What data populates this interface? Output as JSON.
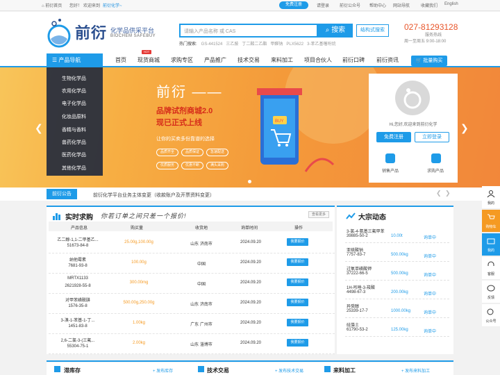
{
  "topbar": {
    "home": "前衍首页",
    "greeting": "您好！",
    "welcome": "欢迎来到",
    "site": "前衍化学~",
    "register": "免费注册",
    "login": "请登录",
    "wechat": "前衍公众号",
    "help": "帮助中心",
    "sitemap": "网站导航",
    "favorite": "收藏我们",
    "english": "English"
  },
  "header": {
    "logo_cn": "前衍",
    "logo_sub1": "化学品供采平台",
    "logo_sub2": "BIOCHEM SAFEBUY",
    "search_placeholder": "请输入产品名称 或 CAS",
    "search_btn": "搜索",
    "struct_search": "结构式搜索",
    "hot_label": "热门搜索:",
    "hot_words": [
      "GS-441524",
      "三乙胺",
      "丁二酸二乙酯",
      "甲醛钠",
      "PLX5622",
      "3-苯乙基噻吩烷"
    ],
    "phone": "027-81293128",
    "service_label": "服务热线",
    "service_time": "周一至周五 9:00-18:00"
  },
  "nav": {
    "category_head": "产品导航",
    "items": [
      "首页",
      "现货商城",
      "求购专区",
      "产品推广",
      "技术交易",
      "来料加工",
      "项目合伙人",
      "前衍口碑",
      "前衍资讯"
    ],
    "hot_badge": "HOT",
    "bulk_buy": "批量购买"
  },
  "categories": [
    "生物化学品",
    "农用化学品",
    "电子化学品",
    "化妆品原料",
    "香精与香料",
    "兽药化学品",
    "医药化学品",
    "其他化学品"
  ],
  "banner": {
    "title": "前衍 ——",
    "line1": "品牌试剂商城2.0",
    "line2": "现已正式上线",
    "line3": "让你的买卖多份靠谱的选择",
    "tags": [
      "品质齐全",
      "品质保证",
      "急速配送",
      "优质服务",
      "优惠不断",
      "满头采购"
    ],
    "phone_badge": "BUY"
  },
  "user_card": {
    "hi": "Hi,您好,欢迎来到前衍化学",
    "register": "免费注册",
    "login": "立即登录",
    "sell": "销售产品",
    "buy": "求购产品"
  },
  "notice": {
    "tag": "前衍公告",
    "text": "前衍化学平台业务主体变更（收款账户及开票资料变更）"
  },
  "purchase": {
    "title": "实时求购",
    "slogan": "你若订单之间只差一个报价!",
    "more": "查看更多",
    "headers": [
      "产品信息",
      "购买量",
      "收货地",
      "询单时间",
      "操作"
    ],
    "quote_label": "我要报价",
    "rows": [
      {
        "name": "乙二醇-1,1-二甲基乙...",
        "cas": "51673-84-8",
        "qty": "25.00g,100.00g",
        "loc": "山东 济南市",
        "date": "2024.09.20"
      },
      {
        "name": "纳他霉素",
        "cas": "7681-93-8",
        "qty": "100.00g",
        "loc": "中国",
        "date": "2024.09.20"
      },
      {
        "name": "MRTX1133",
        "cas": "2621928-55-8",
        "qty": "300.00mg",
        "loc": "中国",
        "date": "2024.09.20"
      },
      {
        "name": "对甲苯磺酰肼",
        "cas": "1576-35-8",
        "qty": "500.00g,250.00g",
        "loc": "山东 济南市",
        "date": "2024.09.20"
      },
      {
        "name": "3-溴-1-苯基-1-丁...",
        "cas": "1451-83-8",
        "qty": "1.00kg",
        "loc": "广东 广州市",
        "date": "2024.09.20"
      },
      {
        "name": "2,6-二氯-3-(三氟...",
        "cas": "55304-75-1",
        "qty": "2.00kg",
        "loc": "山东 淄博市",
        "date": "2024.09.20"
      }
    ]
  },
  "bulk": {
    "title": "大宗动态",
    "status": "询单中",
    "rows": [
      {
        "name": "3-氯-4-氨基三氟甲苯",
        "cas": "39885-50-2",
        "qty": "10.00t"
      },
      {
        "name": "亚硫酸钠",
        "cas": "7757-83-7",
        "qty": "500.00kg"
      },
      {
        "name": "过氧单磺酸钾",
        "cas": "37222-66-5",
        "qty": "500.00kg"
      },
      {
        "name": "1H-吲唑-3-羧酸",
        "cas": "4498-67-3",
        "qty": "200.00kg"
      },
      {
        "name": "异癸醇",
        "cas": "25339-17-7",
        "qty": "1000.00kg"
      },
      {
        "name": "硅藻土",
        "cas": "61790-53-2",
        "qty": "125.00kg"
      }
    ]
  },
  "bottom": {
    "stock": "滞库存",
    "stock_link": "+ 发布库存",
    "tech": "技术交易",
    "tech_link": "+ 发布技术交易",
    "process": "来料加工",
    "process_link": "+ 发布来料加工"
  },
  "sidebar": [
    "我的",
    "购物车",
    "我的",
    "客服",
    "反馈",
    "公众号"
  ],
  "colors": {
    "accent": "#1e9be8",
    "orange": "#f59a22",
    "phone": "#e8552a"
  }
}
